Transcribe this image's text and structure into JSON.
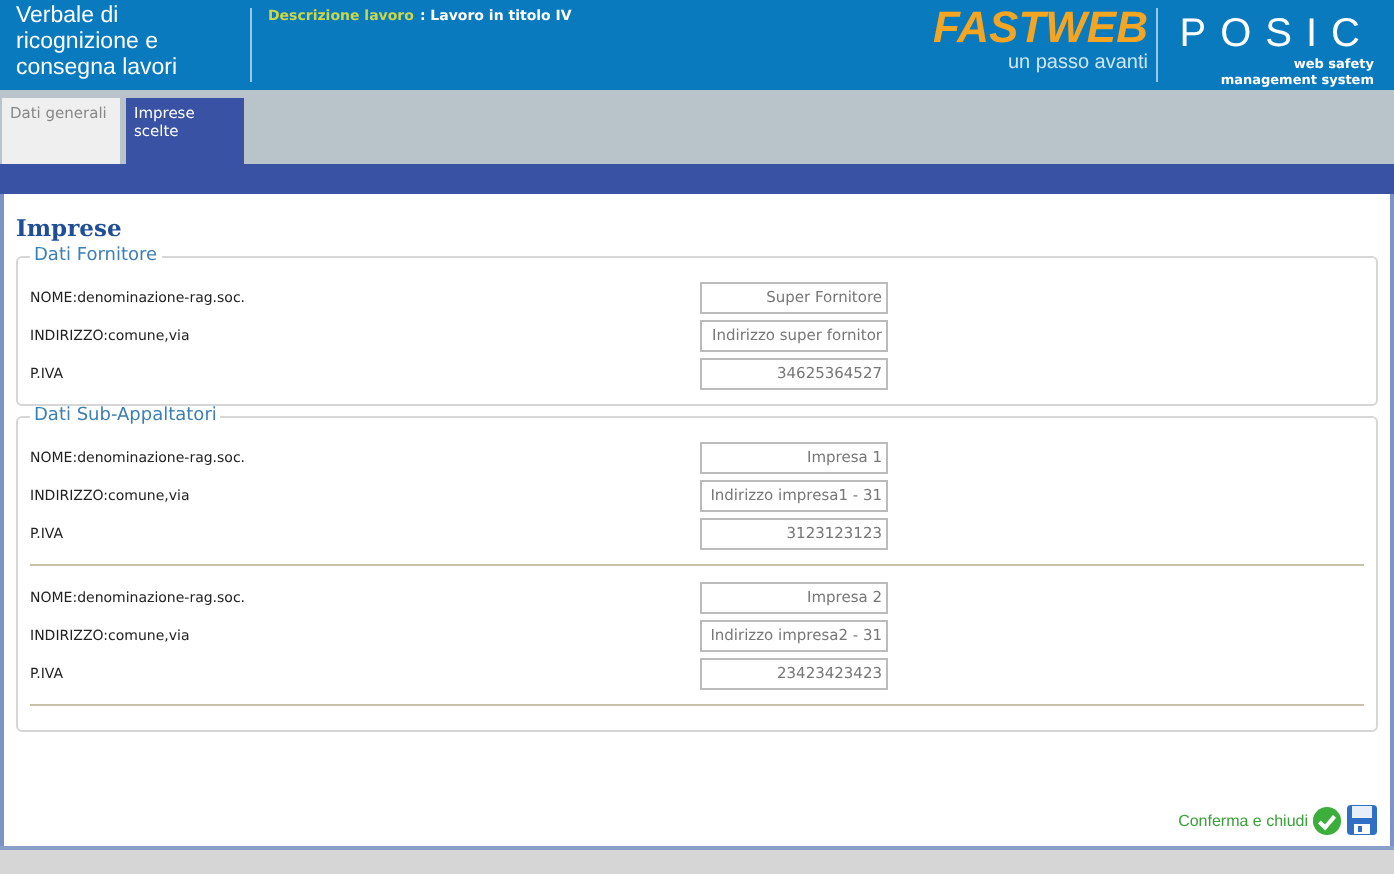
{
  "header": {
    "title": "Verbale di ricognizione e consegna lavori",
    "description_label": "Descrizione lavoro",
    "description_value": ": Lavoro in titolo IV",
    "brand": "FASTWEB",
    "brand_tagline": "un passo avanti",
    "product": "POSIC",
    "product_tagline": "web safety management system"
  },
  "tabs": [
    {
      "label": "Dati generali",
      "selected": false
    },
    {
      "label": "Imprese scelte",
      "selected": true
    }
  ],
  "page_title": "Imprese",
  "sections": [
    {
      "legend": "Dati Fornitore",
      "groups": [
        {
          "fields": [
            {
              "label": "NOME:denominazione-rag.soc.",
              "value": "Super Fornitore"
            },
            {
              "label": "INDIRIZZO:comune,via",
              "value": "Indirizzo super fornitor"
            },
            {
              "label": "P.IVA",
              "value": "34625364527"
            }
          ]
        }
      ]
    },
    {
      "legend": "Dati Sub-Appaltatori",
      "groups": [
        {
          "fields": [
            {
              "label": "NOME:denominazione-rag.soc.",
              "value": "Impresa 1"
            },
            {
              "label": "INDIRIZZO:comune,via",
              "value": "Indirizzo impresa1 - 31"
            },
            {
              "label": "P.IVA",
              "value": "3123123123"
            }
          ]
        },
        {
          "fields": [
            {
              "label": "NOME:denominazione-rag.soc.",
              "value": "Impresa 2"
            },
            {
              "label": "INDIRIZZO:comune,via",
              "value": "Indirizzo impresa2 - 31"
            },
            {
              "label": "P.IVA",
              "value": "23423423423"
            }
          ]
        }
      ]
    }
  ],
  "confirm": "Conferma e chiudi"
}
